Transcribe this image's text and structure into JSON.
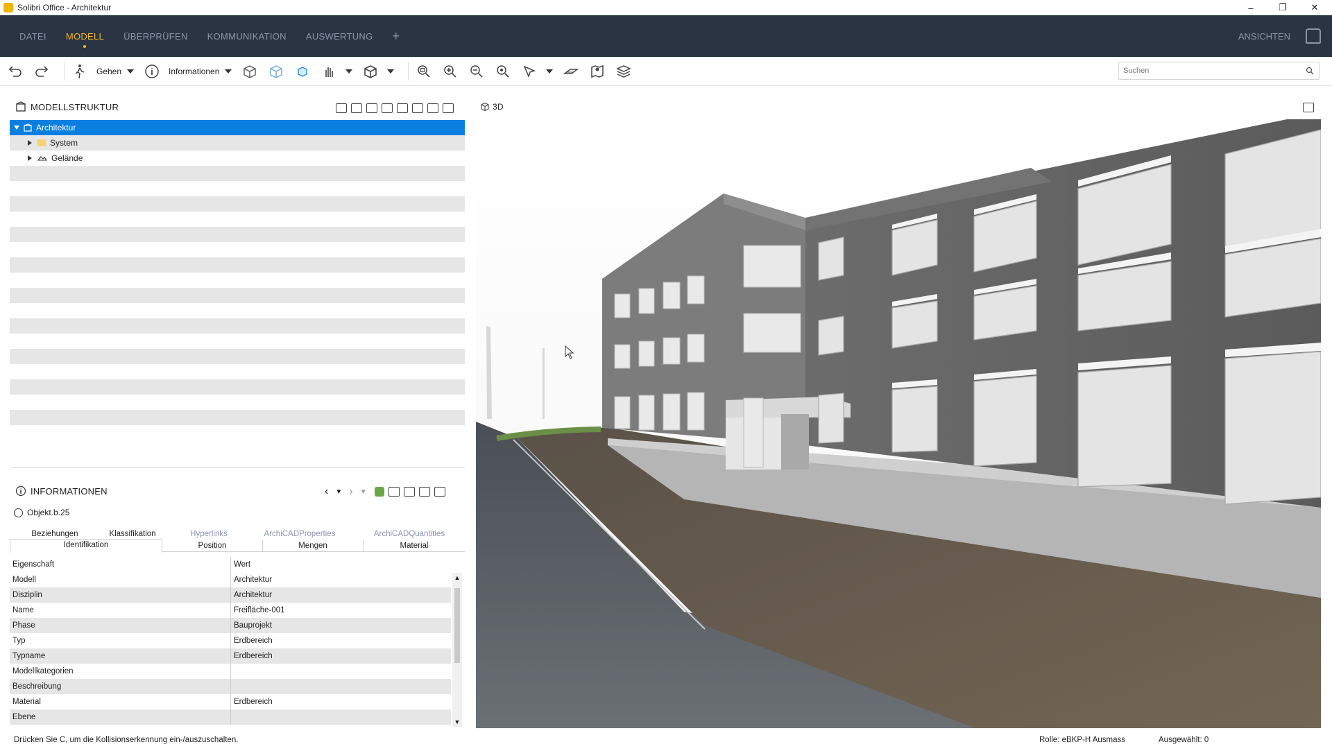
{
  "window": {
    "title": "Solibri Office - Architektur"
  },
  "menu": {
    "items": [
      "DATEI",
      "MODELL",
      "ÜBERPRÜFEN",
      "KOMMUNIKATION",
      "AUSWERTUNG"
    ],
    "active": "MODELL",
    "plus": "+",
    "right_label": "ANSICHTEN"
  },
  "toolbar": {
    "walk_label": "Gehen",
    "info_label": "Informationen",
    "search_placeholder": "Suchen"
  },
  "model_structure": {
    "title": "MODELLSTRUKTUR",
    "tree": [
      {
        "label": "Architektur",
        "selected": true,
        "icon": "building-icon"
      },
      {
        "label": "System",
        "icon": "folder-icon"
      },
      {
        "label": "Gelände",
        "icon": "terrain-icon"
      }
    ]
  },
  "viewport": {
    "label": "3D"
  },
  "information": {
    "title": "INFORMATIONEN",
    "object": "Objekt.b.25",
    "tabs_row1": [
      "Beziehungen",
      "Klassifikation",
      "Hyperlinks",
      "ArchiCADProperties",
      "ArchiCADQuantities"
    ],
    "tabs_row2": [
      "Identifikation",
      "Position",
      "Mengen",
      "Material"
    ],
    "columns": [
      "Eigenschaft",
      "Wert"
    ],
    "rows": [
      [
        "Modell",
        "Architektur"
      ],
      [
        "Disziplin",
        "Architektur"
      ],
      [
        "Name",
        "Freifläche-001"
      ],
      [
        "Phase",
        "Bauprojekt"
      ],
      [
        "Typ",
        "Erdbereich"
      ],
      [
        "Typname",
        "Erdbereich"
      ],
      [
        "Modellkategorien",
        ""
      ],
      [
        "Beschreibung",
        ""
      ],
      [
        "Material",
        "Erdbereich"
      ],
      [
        "Ebene",
        ""
      ]
    ]
  },
  "status": {
    "hint": "Drücken Sie C, um die Kollisionserkennung ein-/auszuschalten.",
    "role": "Rolle: eBKP-H Ausmass",
    "selected": "Ausgewählt: 0"
  },
  "colors": {
    "accent": "#f2b827",
    "menubar": "#2b3442",
    "selection": "#0a7fe0"
  }
}
